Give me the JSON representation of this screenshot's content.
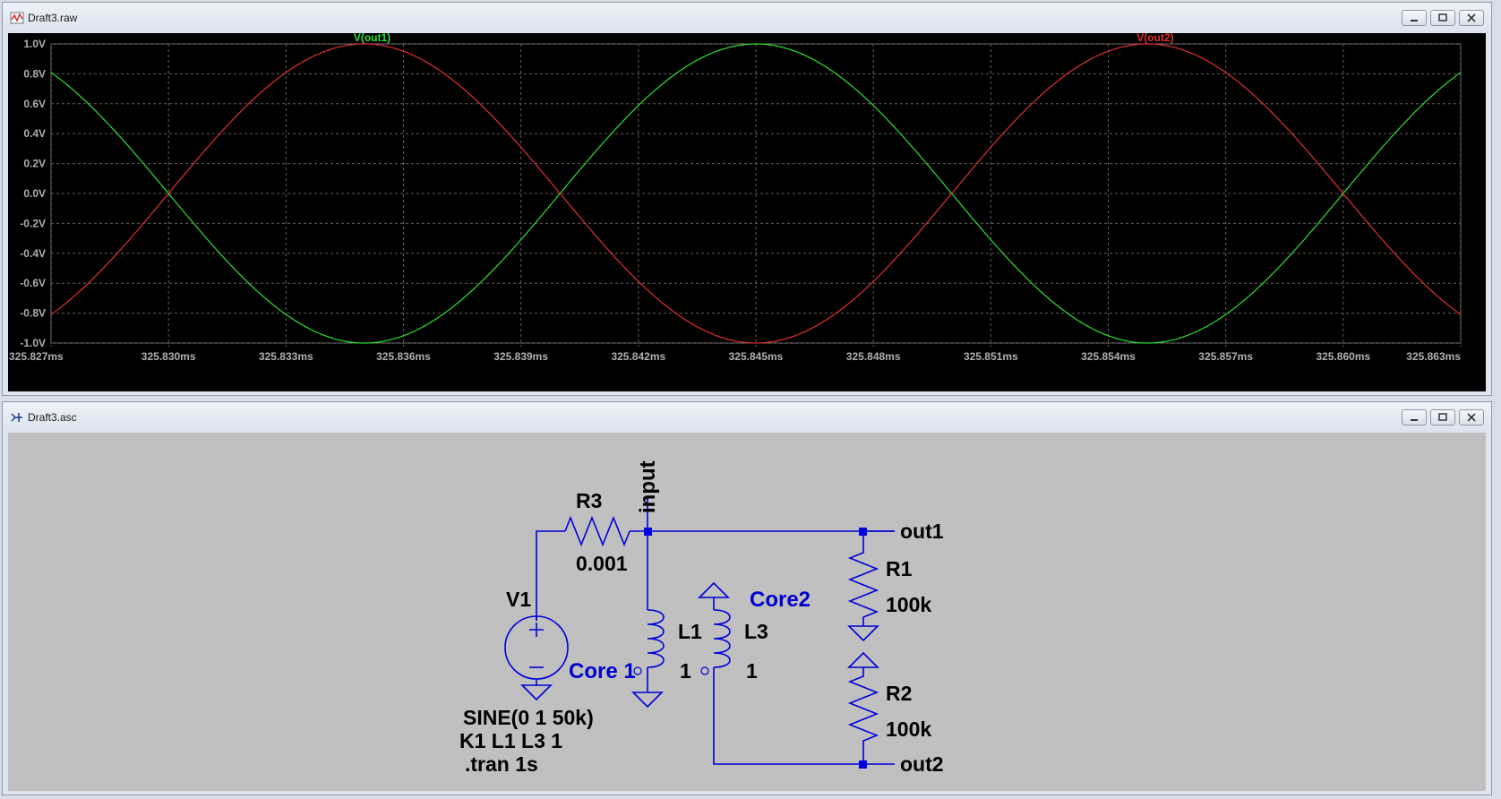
{
  "windows": {
    "raw": {
      "title": "Draft3.raw"
    },
    "asc": {
      "title": "Draft3.asc"
    }
  },
  "colors": {
    "plot_bg": "#000000",
    "grid": "#606060",
    "axis_text": "#b0b0b0",
    "trace_out1": "#2ee02e",
    "trace_out2": "#e03030",
    "schematic_bg": "#c0c0c0",
    "wire": "#0000d8",
    "component": "#0000a8",
    "label_text": "#000000",
    "core_label": "#0000cc"
  },
  "icons": {
    "raw": "waveform-icon",
    "asc": "schematic-icon",
    "buttons": [
      "minimize-icon",
      "maximize-icon",
      "close-icon"
    ]
  },
  "chart_data": {
    "type": "line",
    "x_unit": "ms",
    "x_ticks": [
      "325.827ms",
      "325.830ms",
      "325.833ms",
      "325.836ms",
      "325.839ms",
      "325.842ms",
      "325.845ms",
      "325.848ms",
      "325.851ms",
      "325.854ms",
      "325.857ms",
      "325.860ms",
      "325.863ms"
    ],
    "xlim": [
      325.827,
      325.863
    ],
    "y_ticks": [
      "1.0V",
      "0.8V",
      "0.6V",
      "0.4V",
      "0.2V",
      "0.0V",
      "-0.2V",
      "-0.4V",
      "-0.6V",
      "-0.8V",
      "-1.0V"
    ],
    "ylim": [
      -1.0,
      1.0
    ],
    "grid": true,
    "legend_placement": "top",
    "series": [
      {
        "name": "V(out1)",
        "function": "-sin(2*pi*50000*(t-325.830ms))",
        "frequency_khz": 50,
        "amplitude": 1,
        "zero_crossing_ms": 325.83,
        "sample_points": [
          [
            325.827,
            0.77
          ],
          [
            325.83,
            0.0
          ],
          [
            325.835,
            -1.0
          ],
          [
            325.845,
            1.0
          ],
          [
            325.855,
            -1.0
          ],
          [
            325.863,
            0.81
          ]
        ]
      },
      {
        "name": "V(out2)",
        "function": "sin(2*pi*50000*(t-325.830ms))",
        "frequency_khz": 50,
        "amplitude": 1,
        "zero_crossing_ms": 325.83,
        "sample_points": [
          [
            325.827,
            -0.77
          ],
          [
            325.83,
            0.0
          ],
          [
            325.835,
            1.0
          ],
          [
            325.845,
            -1.0
          ],
          [
            325.855,
            1.0
          ],
          [
            325.863,
            -0.81
          ]
        ]
      }
    ]
  },
  "schematic": {
    "net_labels": {
      "input": "input",
      "out1": "out1",
      "out2": "out2"
    },
    "components": {
      "R3": {
        "name": "R3",
        "value": "0.001"
      },
      "R1": {
        "name": "R1",
        "value": "100k"
      },
      "R2": {
        "name": "R2",
        "value": "100k"
      },
      "V1": {
        "name": "V1",
        "value": "SINE(0 1 50k)"
      },
      "L1": {
        "name": "L1",
        "value": "1"
      },
      "L3": {
        "name": "L3",
        "value": "1"
      }
    },
    "cores": {
      "core1": "Core 1",
      "core2": "Core2"
    },
    "directives": {
      "k": "K1 L1 L3 1",
      "tran": ".tran 1s"
    }
  }
}
